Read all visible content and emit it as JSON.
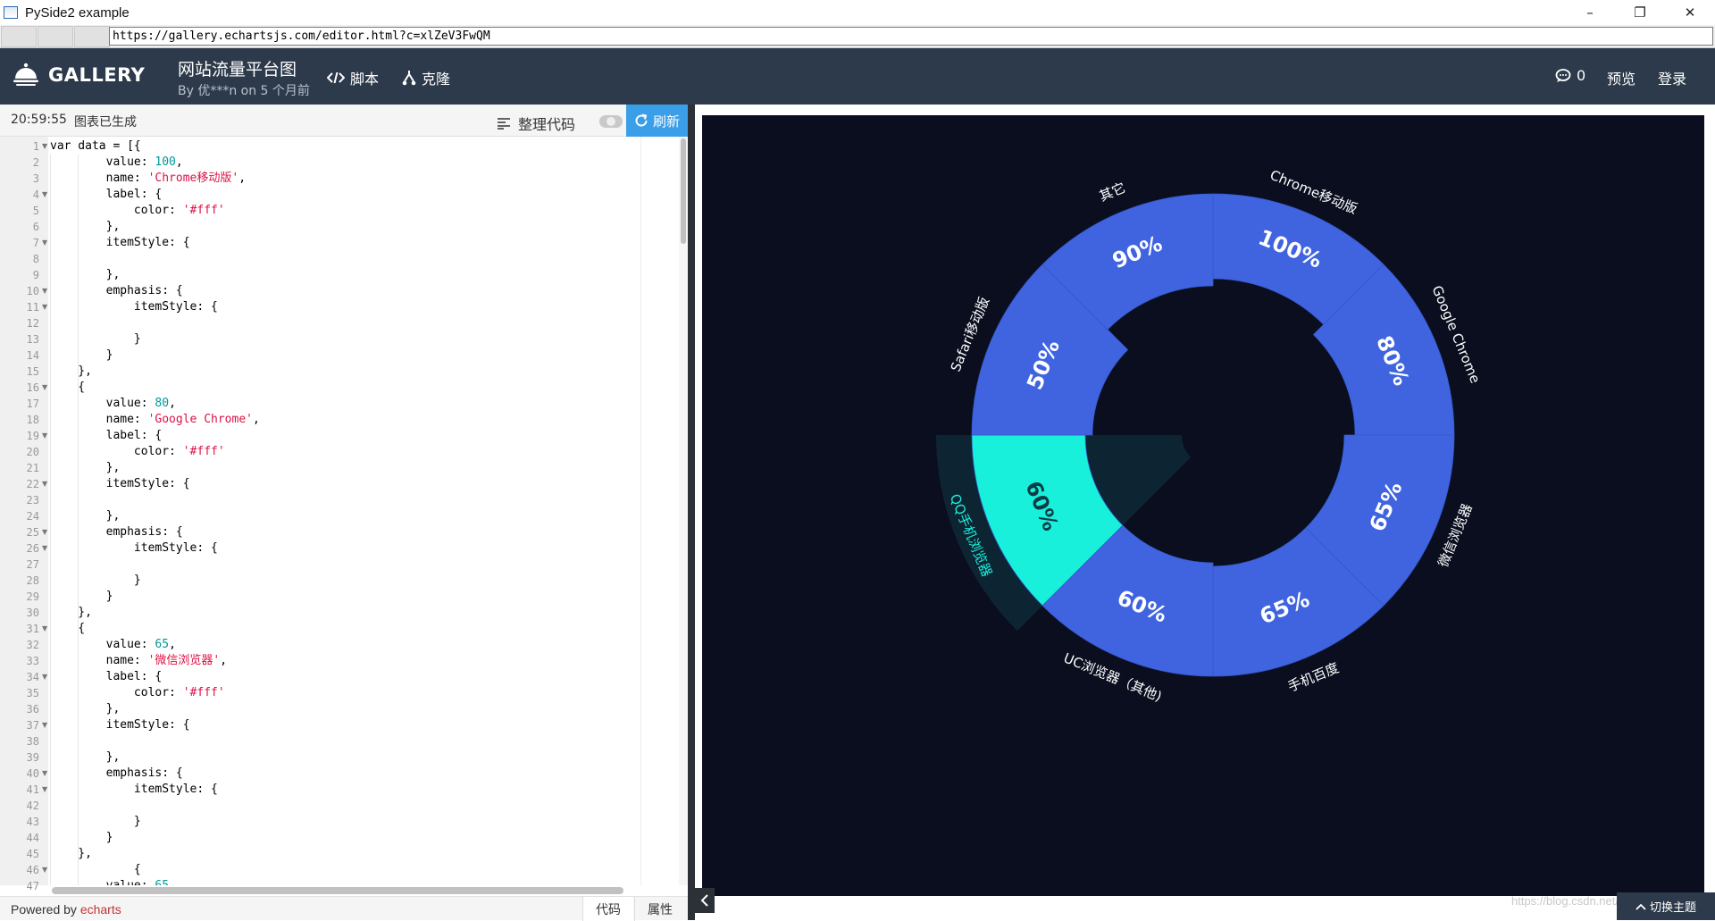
{
  "window": {
    "title": "PySide2 example",
    "minimize": "–",
    "maximize": "❐",
    "close": "✕"
  },
  "address": {
    "url": "https://gallery.echartsjs.com/editor.html?c=xlZeV3FwQM"
  },
  "header": {
    "logo_text": "GALLERY",
    "page_title": "网站流量平台图",
    "meta": "By 优***n on 5 个月前",
    "script_label": "脚本",
    "clone_label": "克隆",
    "comments_count": "0",
    "preview_label": "预览",
    "login_label": "登录"
  },
  "toolbar": {
    "time": "20:59:55",
    "status": "图表已生成",
    "format_label": "整理代码",
    "refresh_label": "刷新"
  },
  "editor": {
    "visible_lines": 47,
    "lines": [
      [
        {
          "t": "var data = [{"
        }
      ],
      [
        {
          "t": "        value: "
        },
        {
          "t": "100",
          "c": "num"
        },
        {
          "t": ","
        }
      ],
      [
        {
          "t": "        name: "
        },
        {
          "t": "'Chrome移动版'",
          "c": "str"
        },
        {
          "t": ","
        }
      ],
      [
        {
          "t": "        label: {"
        }
      ],
      [
        {
          "t": "            color: "
        },
        {
          "t": "'#fff'",
          "c": "str"
        }
      ],
      [
        {
          "t": "        },"
        }
      ],
      [
        {
          "t": "        itemStyle: {"
        }
      ],
      [
        {
          "t": ""
        }
      ],
      [
        {
          "t": "        },"
        }
      ],
      [
        {
          "t": "        emphasis: {"
        }
      ],
      [
        {
          "t": "            itemStyle: {"
        }
      ],
      [
        {
          "t": ""
        }
      ],
      [
        {
          "t": "            }"
        }
      ],
      [
        {
          "t": "        }"
        }
      ],
      [
        {
          "t": "    },"
        }
      ],
      [
        {
          "t": "    {"
        }
      ],
      [
        {
          "t": "        value: "
        },
        {
          "t": "80",
          "c": "num"
        },
        {
          "t": ","
        }
      ],
      [
        {
          "t": "        name: "
        },
        {
          "t": "'Google Chrome'",
          "c": "str"
        },
        {
          "t": ","
        }
      ],
      [
        {
          "t": "        label: {"
        }
      ],
      [
        {
          "t": "            color: "
        },
        {
          "t": "'#fff'",
          "c": "str"
        }
      ],
      [
        {
          "t": "        },"
        }
      ],
      [
        {
          "t": "        itemStyle: {"
        }
      ],
      [
        {
          "t": ""
        }
      ],
      [
        {
          "t": "        },"
        }
      ],
      [
        {
          "t": "        emphasis: {"
        }
      ],
      [
        {
          "t": "            itemStyle: {"
        }
      ],
      [
        {
          "t": ""
        }
      ],
      [
        {
          "t": "            }"
        }
      ],
      [
        {
          "t": "        }"
        }
      ],
      [
        {
          "t": "    },"
        }
      ],
      [
        {
          "t": "    {"
        }
      ],
      [
        {
          "t": "        value: "
        },
        {
          "t": "65",
          "c": "num"
        },
        {
          "t": ","
        }
      ],
      [
        {
          "t": "        name: "
        },
        {
          "t": "'微信浏览器'",
          "c": "str"
        },
        {
          "t": ","
        }
      ],
      [
        {
          "t": "        label: {"
        }
      ],
      [
        {
          "t": "            color: "
        },
        {
          "t": "'#fff'",
          "c": "str"
        }
      ],
      [
        {
          "t": "        },"
        }
      ],
      [
        {
          "t": "        itemStyle: {"
        }
      ],
      [
        {
          "t": ""
        }
      ],
      [
        {
          "t": "        },"
        }
      ],
      [
        {
          "t": "        emphasis: {"
        }
      ],
      [
        {
          "t": "            itemStyle: {"
        }
      ],
      [
        {
          "t": ""
        }
      ],
      [
        {
          "t": "            }"
        }
      ],
      [
        {
          "t": "        }"
        }
      ],
      [
        {
          "t": "    },"
        }
      ],
      [
        {
          "t": "            {"
        }
      ],
      [
        {
          "t": "        value: "
        },
        {
          "t": "65",
          "c": "num"
        }
      ]
    ],
    "fold_lines": [
      1,
      4,
      7,
      10,
      11,
      16,
      19,
      22,
      25,
      26,
      31,
      34,
      37,
      40,
      41,
      46
    ]
  },
  "footer": {
    "powered_prefix": "Powered by ",
    "powered_link": "echarts",
    "tab_code": "代码",
    "tab_props": "属性"
  },
  "chart_panel": {
    "watermark": "https://blog.csdn.net/haozhanb",
    "theme_label": "切换主题"
  },
  "colors": {
    "header_bg": "#2d3a4b",
    "chart_bg": "#0a0e1f",
    "slice": "#4064e0",
    "slice_highlight": "#18f0dc",
    "highlight_shadow": "#0d2433",
    "refresh_bg": "#3a9ee8"
  },
  "chart_data": {
    "type": "pie",
    "subtype": "rose",
    "series": [
      {
        "data": [
          {
            "name": "Chrome移动版",
            "value": 100,
            "label": "100%"
          },
          {
            "name": "Google Chrome",
            "value": 80,
            "label": "80%"
          },
          {
            "name": "微信浏览器",
            "value": 65,
            "label": "65%"
          },
          {
            "name": "手机百度",
            "value": 65,
            "label": "65%"
          },
          {
            "name": "UC浏览器（其他)",
            "value": 60,
            "label": "60%"
          },
          {
            "name": "QQ手机浏览器",
            "value": 60,
            "label": "60%",
            "highlighted": true
          },
          {
            "name": "Safari移动版",
            "value": 50,
            "label": "50%"
          },
          {
            "name": "其它",
            "value": 90,
            "label": "90%"
          }
        ]
      }
    ]
  }
}
